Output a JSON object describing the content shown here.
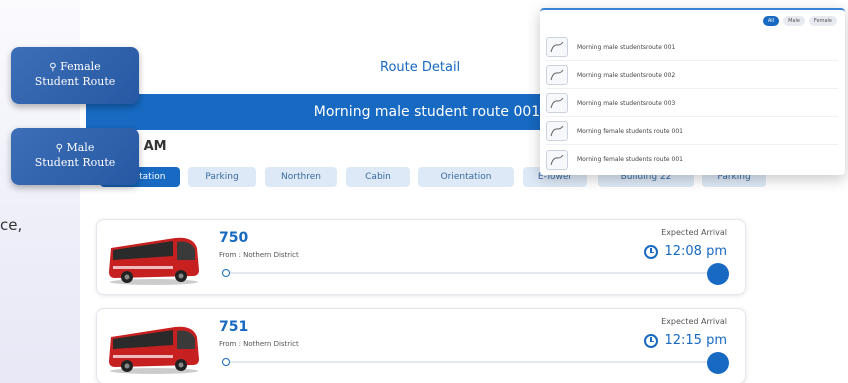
{
  "left_text": "ce,",
  "header": {
    "title": "Route Detail"
  },
  "banner": {
    "route_name": "Morning male student route 001"
  },
  "time": "9 AM",
  "stops": [
    "Orientation",
    "Parking",
    "Northren",
    "Cabin",
    "Orientation",
    "E-Tower",
    "Building 22",
    "Parking"
  ],
  "active_stop_index": 0,
  "buses": [
    {
      "number": "750",
      "from": "From : Nothern District",
      "expected_label": "Expected Arrival",
      "time": "12:08 pm"
    },
    {
      "number": "751",
      "from": "From : Nothern District",
      "expected_label": "Expected Arrival",
      "time": "12:15 pm"
    }
  ],
  "chips": [
    {
      "label_line1": "Female",
      "label_line2": "Student Route",
      "icon": "location-pin-icon"
    },
    {
      "label_line1": "Male",
      "label_line2": "Student Route",
      "icon": "location-pin-icon"
    }
  ],
  "popup": {
    "filters": [
      {
        "label": "All",
        "active": true
      },
      {
        "label": "Male",
        "active": false
      },
      {
        "label": "Female",
        "active": false
      }
    ],
    "routes": [
      "Morning male studentsroute 001",
      "Morning male studentsroute 002",
      "Morning male studentsroute 003",
      "Morning female students route 001",
      "Morning female students route 001"
    ]
  },
  "colors": {
    "accent": "#1769c2",
    "chip": "#2d63ae"
  }
}
